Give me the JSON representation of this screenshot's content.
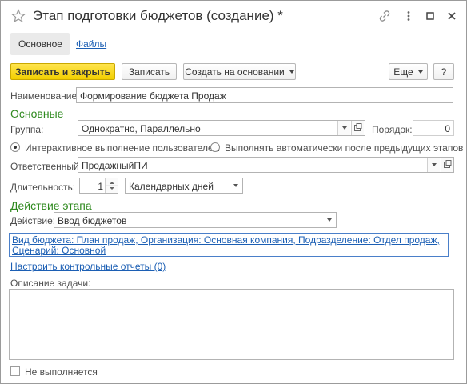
{
  "window": {
    "title": "Этап подготовки бюджетов (создание) *",
    "icons": [
      "star-icon",
      "link-icon",
      "more-icon",
      "maximize-icon",
      "close-icon"
    ]
  },
  "tabs": [
    {
      "label": "Основное",
      "active": true
    },
    {
      "label": "Файлы",
      "active": false
    }
  ],
  "toolbar": {
    "save_close": "Записать и закрыть",
    "save": "Записать",
    "create_based": "Создать на основании",
    "more": "Еще",
    "help": "?"
  },
  "form": {
    "name_label": "Наименование:",
    "name_value": "Формирование бюджета Продаж",
    "section_main": "Основные",
    "group_label": "Группа:",
    "group_value": "Однократно, Параллельно",
    "order_label": "Порядок:",
    "order_value": "0",
    "radio_interactive": "Интерактивное выполнение пользователем",
    "radio_auto": "Выполнять автоматически после предыдущих этапов",
    "responsible_label": "Ответственный:",
    "responsible_value": "ПродажныйПИ",
    "duration_label": "Длительность:",
    "duration_value": "1",
    "duration_unit": "Календарных дней",
    "section_action": "Действие этапа",
    "action_label": "Действие:",
    "action_value": "Ввод бюджетов",
    "action_params": "Вид бюджета: План продаж, Организация: Основная компания, Подразделение: Отдел продаж, Сценарий: Основной",
    "control_reports_link": "Настроить контрольные отчеты (0)",
    "task_desc_label": "Описание задачи:",
    "task_desc_value": "",
    "not_performed_label": "Не выполняется"
  },
  "colors": {
    "accent_green": "#2f8a1f",
    "link_blue": "#1c5fb4",
    "primary_yellow": "#f2cf00"
  }
}
